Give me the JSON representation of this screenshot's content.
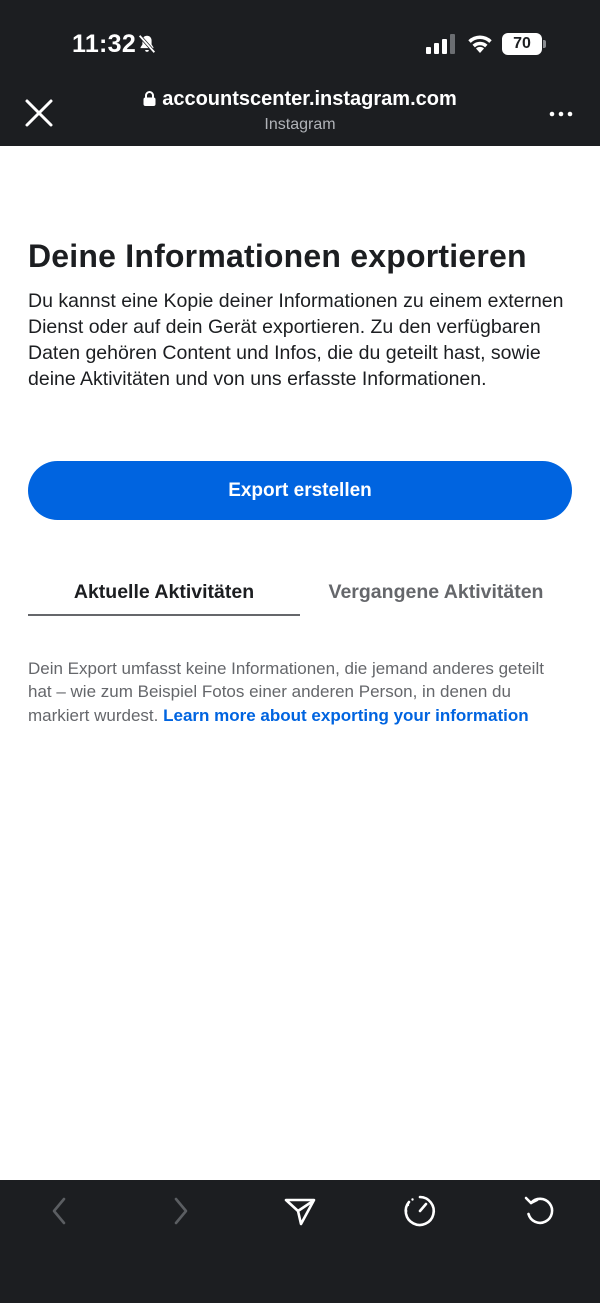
{
  "status_bar": {
    "time": "11:32",
    "battery": "70"
  },
  "browser": {
    "url": "accountscenter.instagram.com",
    "site_name": "Instagram"
  },
  "page": {
    "title": "Deine Informationen exportieren",
    "description": "Du kannst eine Kopie deiner Informationen zu einem externen Dienst oder auf dein Gerät exportieren. Zu den verfügbaren Daten gehören Content und Infos, die du geteilt hast, sowie deine Aktivitäten und von uns erfasste Informationen.",
    "export_button": "Export erstellen",
    "tabs": [
      {
        "label": "Aktuelle Aktivitäten",
        "active": true
      },
      {
        "label": "Vergangene Aktivitäten",
        "active": false
      }
    ],
    "footnote": "Dein Export umfasst keine Informationen, die jemand anderes geteilt hat – wie zum Beispiel Fotos einer anderen Person, in denen du markiert wurdest.",
    "footnote_link": "Learn more about exporting your information"
  },
  "colors": {
    "accent": "#0064e0",
    "dark_bar": "#1c1e21",
    "secondary_text": "#65676b"
  },
  "icons": {
    "close": "close-icon",
    "lock": "lock-icon",
    "more": "more-icon",
    "back": "chevron-left-icon",
    "forward": "chevron-right-icon",
    "share": "send-icon",
    "speed": "speedometer-icon",
    "reload": "reload-icon"
  }
}
